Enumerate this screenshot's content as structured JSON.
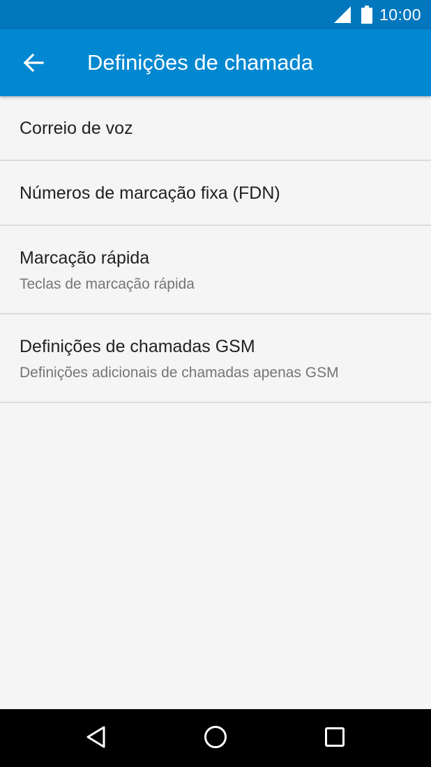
{
  "status_bar": {
    "time": "10:00",
    "icons": [
      "signal-icon",
      "battery-icon"
    ]
  },
  "app_bar": {
    "back_icon": "arrow-left-icon",
    "title": "Definições de chamada",
    "color": "#0288d1",
    "status_color": "#0277bd"
  },
  "settings": {
    "items": [
      {
        "title": "Correio de voz"
      },
      {
        "title": "Números de marcação fixa (FDN)"
      },
      {
        "title": "Marcação rápida",
        "subtitle": "Teclas de marcação rápida"
      },
      {
        "title": "Definições de chamadas GSM",
        "subtitle": "Definições adicionais de chamadas apenas GSM"
      }
    ]
  },
  "nav_bar": {
    "buttons": [
      "nav-back-icon",
      "nav-home-icon",
      "nav-recents-icon"
    ]
  }
}
